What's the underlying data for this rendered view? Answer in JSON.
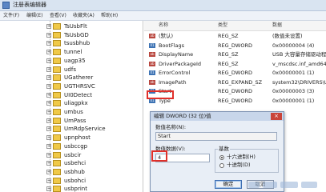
{
  "window": {
    "title": "注册表编辑器"
  },
  "menu": [
    "文件(F)",
    "编辑(E)",
    "查看(V)",
    "收藏夹(A)",
    "帮助(H)"
  ],
  "tree": {
    "items": [
      {
        "label": "TsUsbFlt"
      },
      {
        "label": "TsUsbGD"
      },
      {
        "label": "tsusbhub"
      },
      {
        "label": "tunnel"
      },
      {
        "label": "uagp35"
      },
      {
        "label": "udfs"
      },
      {
        "label": "UGatherer"
      },
      {
        "label": "UGTHRSVC"
      },
      {
        "label": "UI0Detect"
      },
      {
        "label": "uliagpkx"
      },
      {
        "label": "umbus"
      },
      {
        "label": "UmPass"
      },
      {
        "label": "UmRdpService"
      },
      {
        "label": "upnphost"
      },
      {
        "label": "usbccgp"
      },
      {
        "label": "usbcir"
      },
      {
        "label": "usbehci"
      },
      {
        "label": "usbhub"
      },
      {
        "label": "usbohci"
      },
      {
        "label": "usbprint"
      }
    ]
  },
  "list": {
    "headers": {
      "name": "名称",
      "type": "类型",
      "data": "数据"
    },
    "rows": [
      {
        "icon": "string-value-icon",
        "name": "(默认)",
        "type": "REG_SZ",
        "data": "(数值未设置)"
      },
      {
        "icon": "dword-value-icon",
        "name": "BootFlags",
        "type": "REG_DWORD",
        "data": "0x00000004 (4)"
      },
      {
        "icon": "string-value-icon",
        "name": "DisplayName",
        "type": "REG_SZ",
        "data": "USB 大容量存储驱动程序"
      },
      {
        "icon": "string-value-icon",
        "name": "DriverPackageId",
        "type": "REG_SZ",
        "data": "v_mscdsc.inf_amd64_neutra"
      },
      {
        "icon": "dword-value-icon",
        "name": "ErrorControl",
        "type": "REG_DWORD",
        "data": "0x00000001 (1)"
      },
      {
        "icon": "expand-string-icon",
        "name": "ImagePath",
        "type": "REG_EXPAND_SZ",
        "data": "system32\\DRIVERS\\USBST"
      },
      {
        "icon": "dword-value-icon",
        "name": "Start",
        "type": "REG_DWORD",
        "data": "0x00000003 (3)"
      },
      {
        "icon": "dword-value-icon",
        "name": "Type",
        "type": "REG_DWORD",
        "data": "0x00000001 (1)"
      }
    ]
  },
  "dialog": {
    "title": "编辑 DWORD (32 位)值",
    "close_label": "×",
    "name_label": "数值名称(N):",
    "name_value": "Start",
    "data_label": "数值数据(V):",
    "data_value": "4",
    "base_label": "基数",
    "hex_label": "十六进制(H)",
    "dec_label": "十进制(D)",
    "base_selected": "hex",
    "ok_label": "确定",
    "cancel_label": "取消"
  },
  "colors": {
    "highlight": "#e0302a",
    "folder": "#f0c948"
  }
}
